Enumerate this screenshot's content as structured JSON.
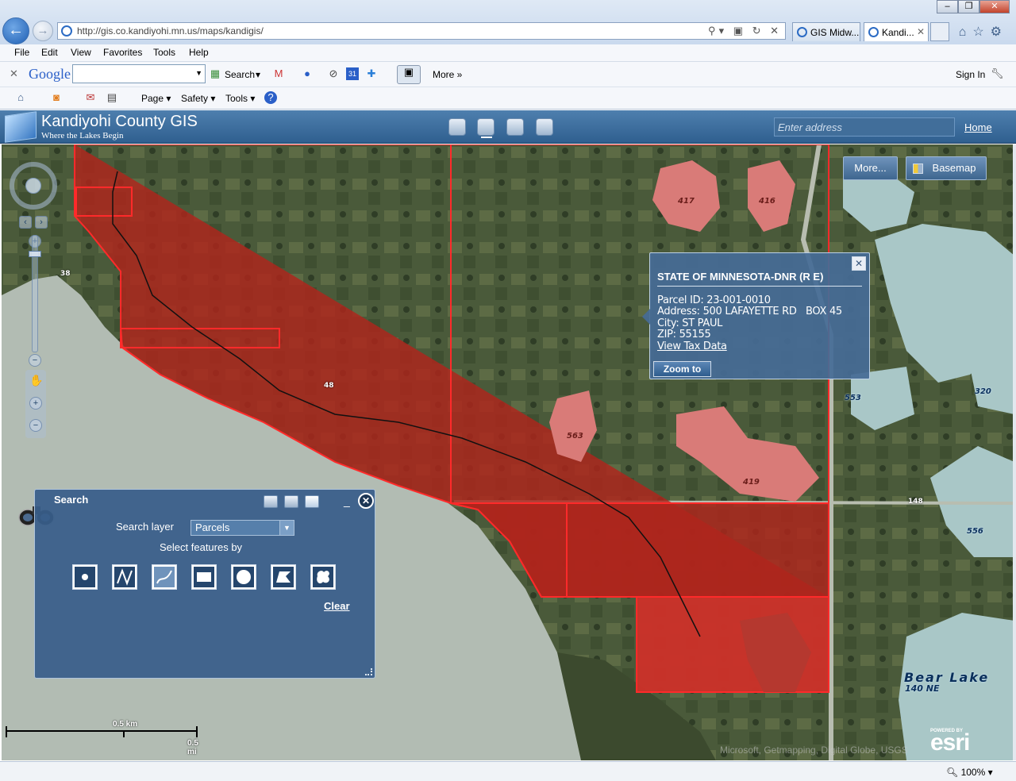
{
  "browser": {
    "url": "http://gis.co.kandiyohi.mn.us/maps/kandigis/",
    "tabs": [
      {
        "label": "GIS Midw..."
      },
      {
        "label": "Kandi..."
      }
    ],
    "menu": [
      "File",
      "Edit",
      "View",
      "Favorites",
      "Tools",
      "Help"
    ],
    "google_toolbar": {
      "logo": "Google",
      "search_label": "Search",
      "more_label": "More",
      "sign_in_label": "Sign In"
    },
    "command_bar": {
      "page_label": "Page",
      "safety_label": "Safety",
      "tools_label": "Tools"
    },
    "zoom_level": "100%"
  },
  "app": {
    "title": "Kandiyohi County GIS",
    "subtitle": "Where the Lakes Begin",
    "address_placeholder": "Enter address",
    "home_label": "Home"
  },
  "map": {
    "more_button": "More...",
    "basemap_button": "Basemap",
    "labels": {
      "lake_417": "417",
      "lake_416": "416",
      "lake_563": "563",
      "lake_419": "419",
      "lake_553": "553",
      "lake_320": "320",
      "lake_556": "556",
      "road_38": "38",
      "road_48": "48",
      "road_148": "148",
      "bear_lake": "Bear Lake",
      "bear_lake_id": "140 NE"
    },
    "scale": {
      "km": "0.5 km",
      "mi": "0.5 mi"
    },
    "esri_powered": "POWERED BY",
    "esri_word": "esri",
    "attribution": "Microsoft, Getmapping, Digital Globe, USGS"
  },
  "popup": {
    "title": "STATE OF MINNESOTA-DNR (R E)",
    "parcel_id": "Parcel ID: 23-001-0010",
    "address": "Address: 500 LAFAYETTE RD   BOX 45",
    "city": "City: ST PAUL",
    "zip": "ZIP: 55155",
    "view_tax_label": "View Tax Data",
    "zoom_to_label": "Zoom to"
  },
  "search_widget": {
    "title": "Search",
    "layer_label": "Search layer",
    "layer_value": "Parcels",
    "select_by_label": "Select features by",
    "clear_label": "Clear"
  },
  "colors": {
    "parcel_fill": "#b0241c",
    "parcel_outline": "#ff2a2a",
    "header_blue": "#3a6a98"
  }
}
